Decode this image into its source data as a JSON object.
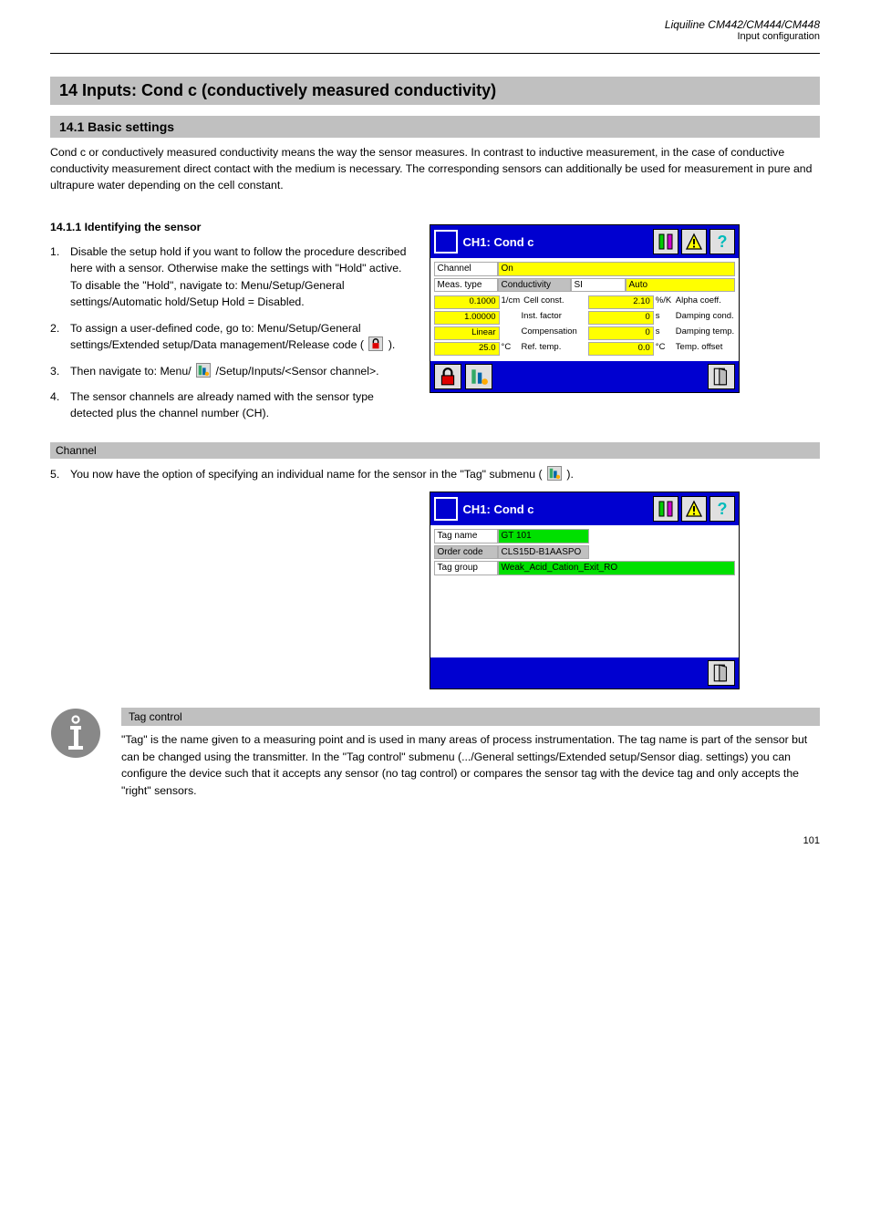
{
  "header": {
    "doc_title": "Liquiline CM442/CM444/CM448",
    "chapter": "Input configuration"
  },
  "sections": {
    "s1_title": "14  Inputs: Cond c (conductively measured conductivity)",
    "s2_title": "14.1  Basic settings",
    "s2_body": "Cond c or conductively measured conductivity means the way the sensor measures. In contrast to inductive measurement, in the case of conductive conductivity measurement direct contact with the medium is necessary. The corresponding sensors can additionally be used for measurement in pure and ultrapure water depending on the cell constant.",
    "s3_title": "14.1.1  Identifying the sensor"
  },
  "steps_a": [
    {
      "num": "1.",
      "text_before": "Disable the setup hold if you want to follow the procedure described here with a sensor. Otherwise make the settings with \"Hold\" active. To disable the \"Hold\", navigate to: Menu/Setup/General settings/Automatic hold/Setup Hold = Disabled."
    },
    {
      "num": "2.",
      "text_before": "To assign a user-defined code, go to: Menu/Setup/General settings/Extended setup/Data management/Release code (",
      "text_after": ")."
    },
    {
      "num": "3.",
      "text_before": "Then navigate to: Menu/",
      "text_after": "/Setup/Inputs/<Sensor channel>."
    },
    {
      "num": "4.",
      "text_before": "The sensor channels are already named with the sensor type detected plus the channel number (CH)."
    }
  ],
  "s_block5": {
    "title": "Channel",
    "num": "5.",
    "text_before": "You now have the option of specifying an individual name for the sensor in the \"Tag\" submenu (",
    "text_after": ")."
  },
  "win1": {
    "title": "CH1: Cond c",
    "row1_label": "Channel",
    "row1_value": "On",
    "row2_label": "Meas. type",
    "row2_val_g": "Conductivity",
    "row2_val_w": "SI",
    "row2_val_y": "Auto",
    "left": [
      {
        "val": "0.1000",
        "unit": "1/cm",
        "name": "Cell const."
      },
      {
        "val": "1.00000",
        "unit": "",
        "name": "Inst. factor"
      },
      {
        "val": "Linear",
        "unit": "",
        "name": "Compensation"
      },
      {
        "val": "25.0",
        "unit": "°C",
        "name": "Ref. temp."
      }
    ],
    "right": [
      {
        "val": "2.10",
        "unit": "%/K",
        "name": "Alpha coeff."
      },
      {
        "val": "0",
        "unit": "s",
        "name": "Damping cond."
      },
      {
        "val": "0",
        "unit": "s",
        "name": "Damping temp."
      },
      {
        "val": "0.0",
        "unit": "°C",
        "name": "Temp. offset"
      }
    ]
  },
  "win2": {
    "title": "CH1: Cond c",
    "row1_label": "Tag name",
    "row1_value": "GT 101",
    "row2_label": "Order code",
    "row2_value": "CLS15D-B1AASPO",
    "row3_label": "Tag group",
    "row3_value": "Weak_Acid_Cation_Exit_RO"
  },
  "tip": {
    "title": "Tag control",
    "body": "\"Tag\" is the name given to a measuring point and is used in many areas of process instrumentation. The tag name is part of the sensor but can be changed using the transmitter. In the \"Tag control\" submenu (.../General settings/Extended setup/Sensor diag. settings) you can configure the device such that it accepts any sensor (no tag control) or compares the sensor tag with the device tag and only accepts the \"right\" sensors."
  },
  "icons": {
    "lock_hint": "lock-icon",
    "gauge_hint": "gauge-icon"
  },
  "page_number": "101"
}
